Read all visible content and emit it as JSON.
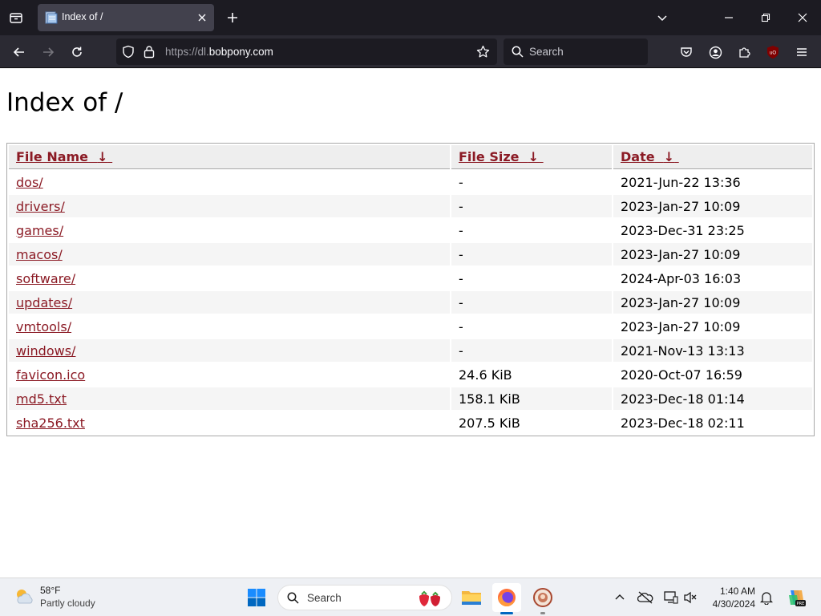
{
  "browser": {
    "tab_title": "Index of /",
    "url_scheme": "https://dl.",
    "url_host": "bobpony.com",
    "search_placeholder": "Search"
  },
  "page": {
    "title": "Index of /",
    "columns": {
      "name": "File Name",
      "size": "File Size",
      "date": "Date",
      "sort_arrow": "↓"
    },
    "rows": [
      {
        "name": "dos/",
        "size": "-",
        "date": "2021-Jun-22 13:36"
      },
      {
        "name": "drivers/",
        "size": "-",
        "date": "2023-Jan-27 10:09"
      },
      {
        "name": "games/",
        "size": "-",
        "date": "2023-Dec-31 23:25"
      },
      {
        "name": "macos/",
        "size": "-",
        "date": "2023-Jan-27 10:09"
      },
      {
        "name": "software/",
        "size": "-",
        "date": "2024-Apr-03 16:03"
      },
      {
        "name": "updates/",
        "size": "-",
        "date": "2023-Jan-27 10:09"
      },
      {
        "name": "vmtools/",
        "size": "-",
        "date": "2023-Jan-27 10:09"
      },
      {
        "name": "windows/",
        "size": "-",
        "date": "2021-Nov-13 13:13"
      },
      {
        "name": "favicon.ico",
        "size": "24.6 KiB",
        "date": "2020-Oct-07 16:59"
      },
      {
        "name": "md5.txt",
        "size": "158.1 KiB",
        "date": "2023-Dec-18 01:14"
      },
      {
        "name": "sha256.txt",
        "size": "207.5 KiB",
        "date": "2023-Dec-18 02:11"
      }
    ]
  },
  "taskbar": {
    "weather_temp": "58°F",
    "weather_condition": "Partly cloudy",
    "search_placeholder": "Search",
    "time": "1:40 AM",
    "date": "4/30/2024",
    "apps": [
      "start-icon",
      "file-explorer-icon",
      "firefox-icon",
      "bobpony-app-icon"
    ]
  },
  "colors": {
    "link": "#8b1a24",
    "chrome_dark": "#1c1b22",
    "toolbar": "#2b2a33",
    "taskbar": "#eef0f4",
    "accent": "#0067c0"
  }
}
